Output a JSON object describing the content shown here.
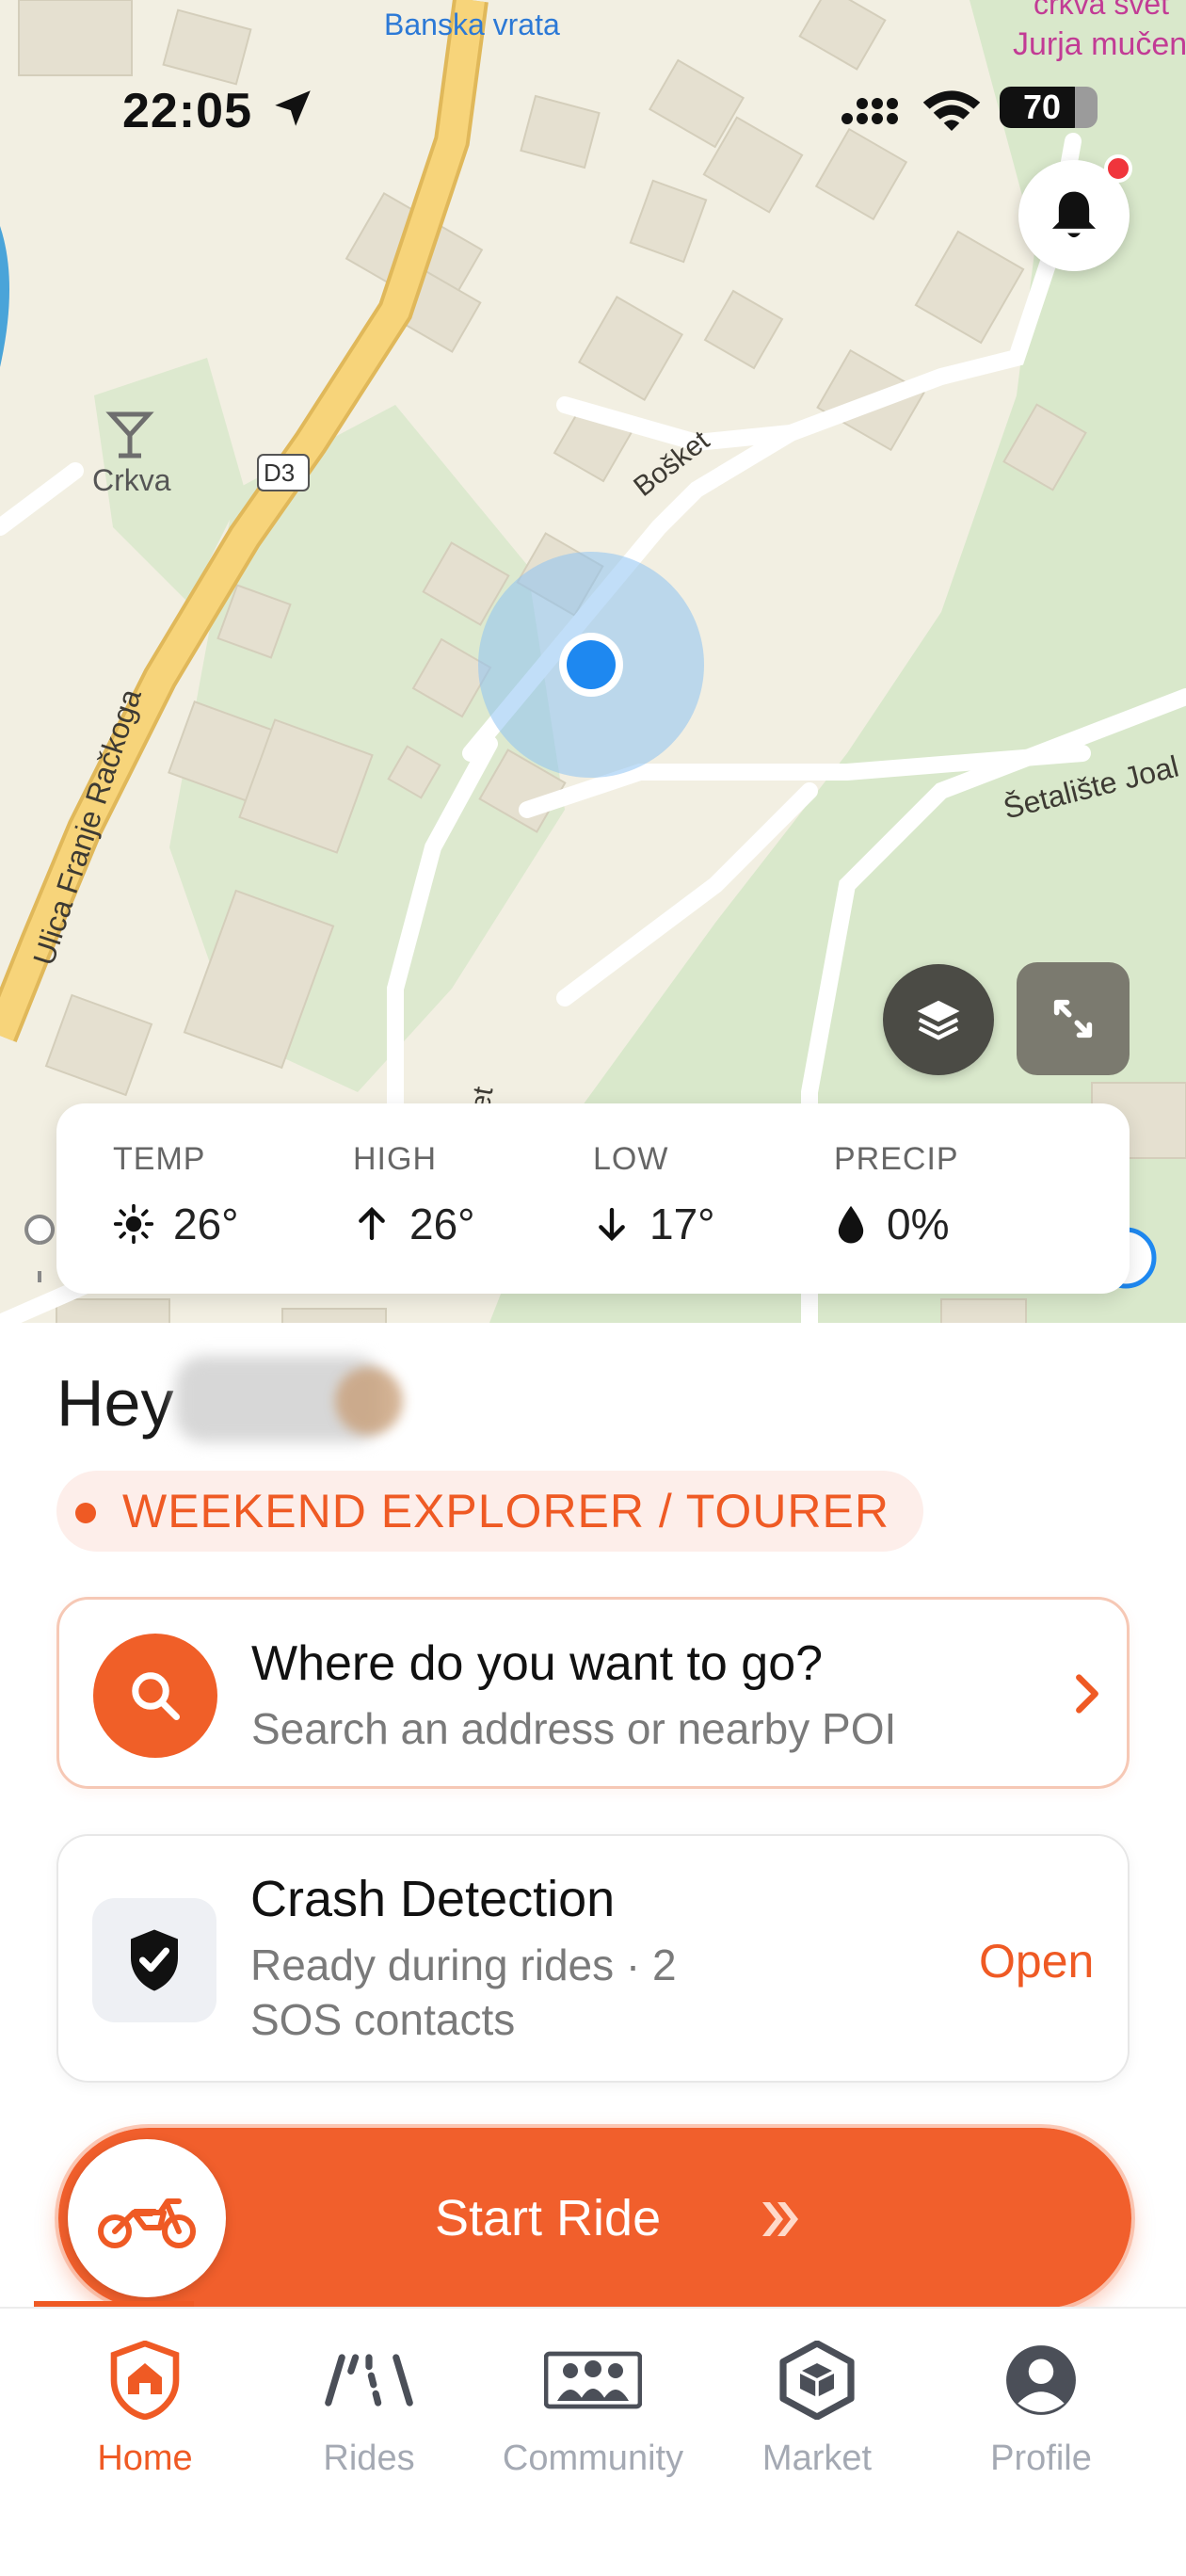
{
  "status_bar": {
    "time": "22:05",
    "battery": "70"
  },
  "map": {
    "labels": {
      "banska_vrata": "Banska vrata",
      "crkva_svet": "crkva svet",
      "jurja_mucen": "Jurja mučen",
      "crkva": "Crkva",
      "road_badge": "D3",
      "bosket": "Bošket",
      "ulica": "Ulica Franje Račkoga",
      "setaliste": "Šetalište Joal",
      "partial_et": "et"
    },
    "colors": {
      "water": "#4aa4d9",
      "highway": "#f7d47a",
      "park": "#d5e6c8",
      "location": "#1e88f0"
    }
  },
  "weather": {
    "temp": {
      "label": "TEMP",
      "value": "26°",
      "icon": "sun-icon"
    },
    "high": {
      "label": "HIGH",
      "value": "26°",
      "icon": "arrow-up-icon"
    },
    "low": {
      "label": "LOW",
      "value": "17°",
      "icon": "arrow-down-icon"
    },
    "precip": {
      "label": "PRECIP",
      "value": "0%",
      "icon": "drop-icon"
    }
  },
  "greeting": {
    "hey": "Hey"
  },
  "rider_type": "WEEKEND EXPLORER / TOURER",
  "search": {
    "title": "Where do you want to go?",
    "subtitle": "Search an address or nearby POI"
  },
  "crash": {
    "title": "Crash Detection",
    "subtitle": "Ready during rides · 2 SOS contacts",
    "action": "Open"
  },
  "start_ride": {
    "label": "Start Ride"
  },
  "tabs": [
    {
      "label": "Home",
      "icon": "home-shield-icon",
      "active": true
    },
    {
      "label": "Rides",
      "icon": "road-icon"
    },
    {
      "label": "Community",
      "icon": "group-icon"
    },
    {
      "label": "Market",
      "icon": "box-icon"
    },
    {
      "label": "Profile",
      "icon": "user-icon"
    }
  ],
  "accent": "#ef5a24"
}
